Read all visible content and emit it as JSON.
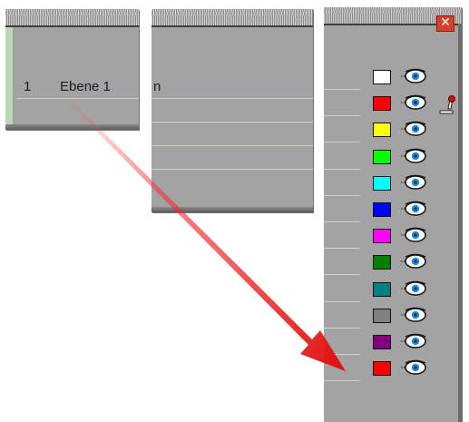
{
  "left_panel": {
    "layer_number": "1",
    "layer_name": "Ebene 1"
  },
  "middle_panel": {
    "partial_text": "n"
  },
  "right_panel": {
    "close_label": "✕",
    "swatches": [
      {
        "color": "#ffffff"
      },
      {
        "color": "#ff0000"
      },
      {
        "color": "#ffff00"
      },
      {
        "color": "#00ff00"
      },
      {
        "color": "#00ffff"
      },
      {
        "color": "#0000ff"
      },
      {
        "color": "#ff00ff"
      },
      {
        "color": "#008000"
      },
      {
        "color": "#008080"
      },
      {
        "color": "#808080"
      },
      {
        "color": "#800080"
      },
      {
        "color": "#ff0000"
      }
    ]
  },
  "icons": {
    "eye": "eye-icon",
    "cursor": "cursor-pen-icon",
    "arrow": "annotation-arrow"
  }
}
